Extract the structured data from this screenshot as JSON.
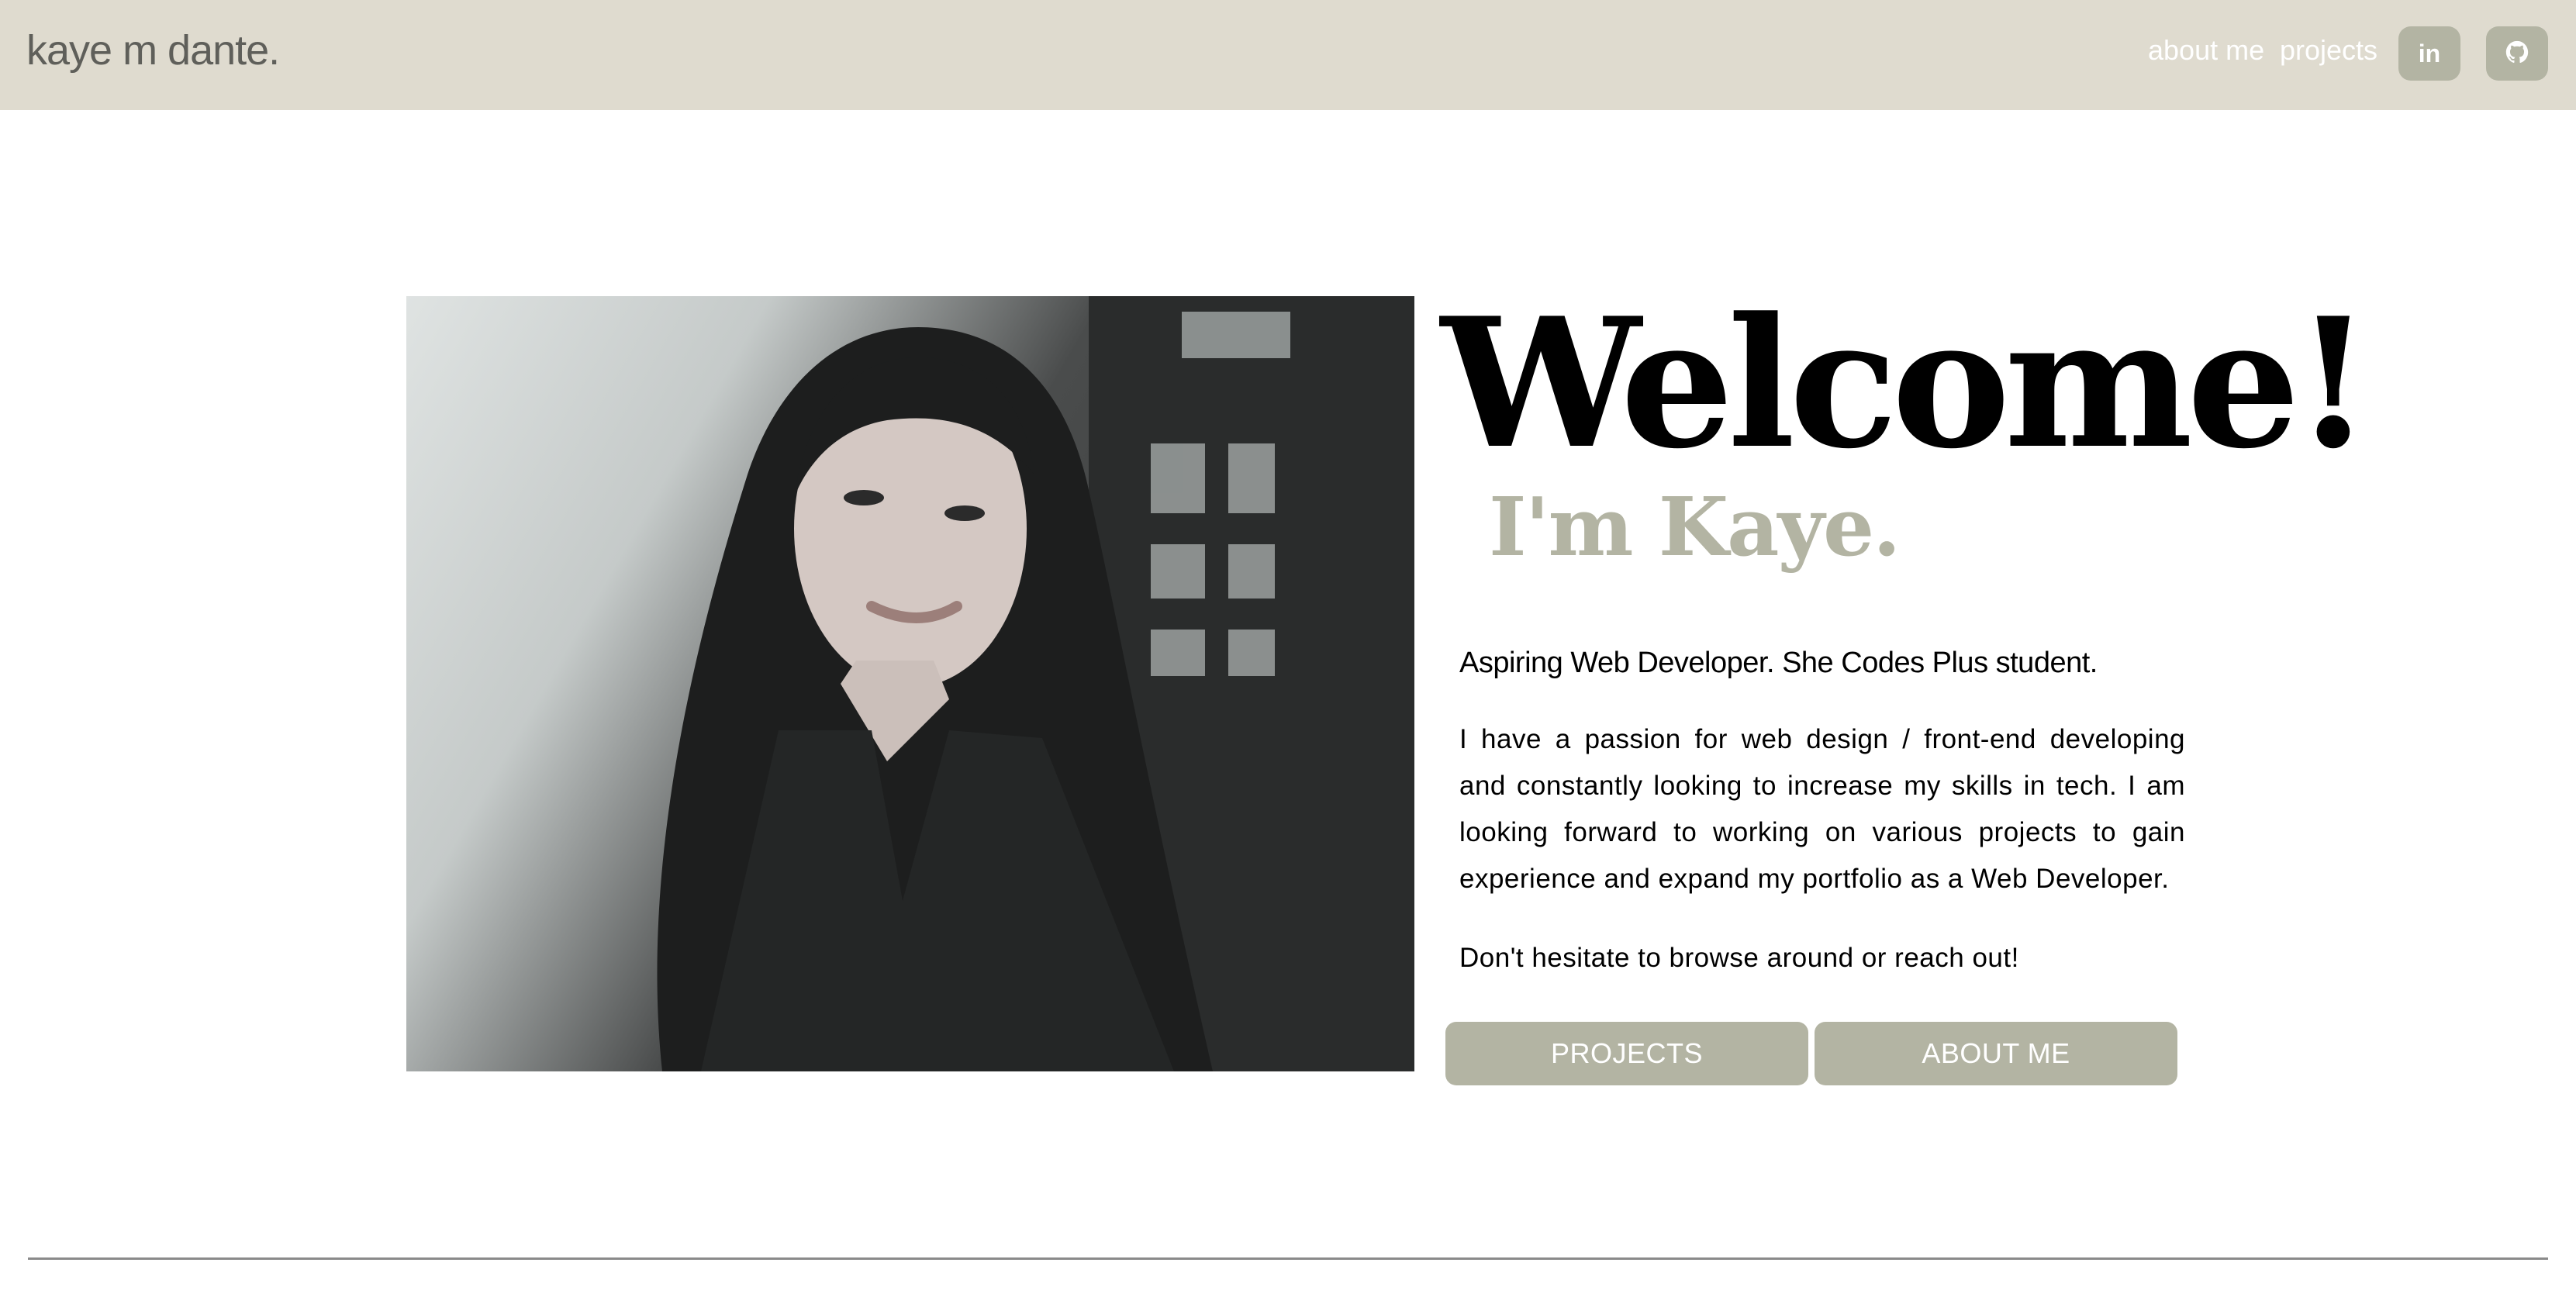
{
  "nav": {
    "brand": "kaye m dante.",
    "links": [
      "about me",
      "projects"
    ],
    "social": [
      {
        "label": "in",
        "icon": "linkedin-icon"
      },
      {
        "label": "",
        "icon": "github-icon"
      }
    ]
  },
  "hero": {
    "photo_alt": "Portrait photo",
    "welcome": "Welcome!",
    "subtitle": "I'm Kaye.",
    "tagline": "Aspiring Web Developer. She Codes Plus student.",
    "intro": "I have a passion for web design / front-end developing and constantly looking to increase my skills in tech. I am looking forward to working on various projects to gain experience and expand my portfolio as a Web Developer.",
    "closing": "Don't hesitate to browse around or reach out!",
    "buttons": [
      "PROJECTS",
      "ABOUT ME"
    ]
  },
  "colors": {
    "nav_background": "#dfdbcf",
    "accent": "#b3b4a3",
    "text": "#000000"
  }
}
